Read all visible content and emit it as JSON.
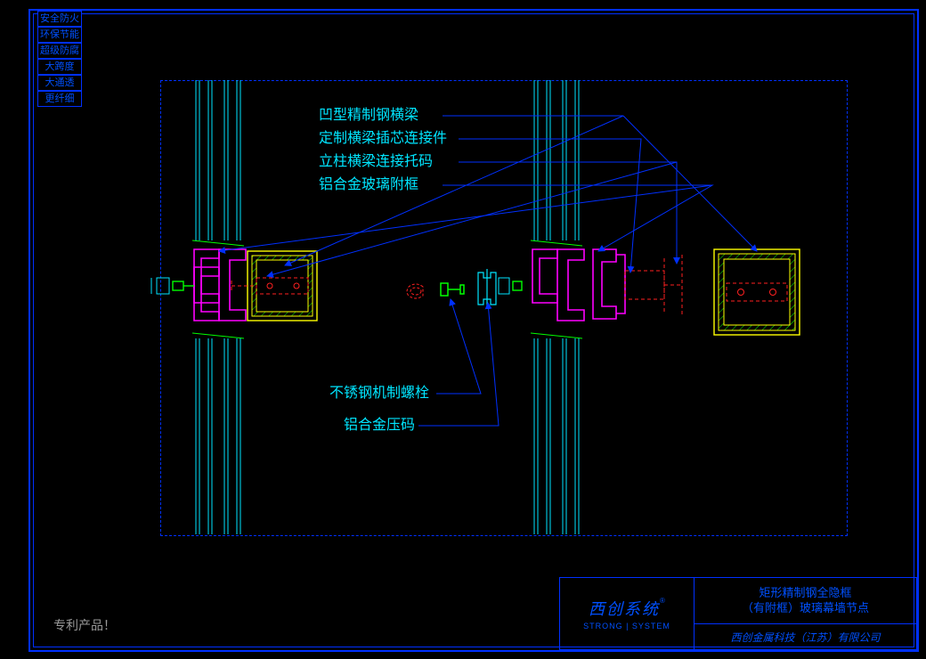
{
  "sidebar": {
    "tags": [
      "安全防火",
      "环保节能",
      "超级防腐",
      "大跨度",
      "大通透",
      "更纤细"
    ]
  },
  "labels": {
    "top1": "凹型精制钢横梁",
    "top2": "定制横梁插芯连接件",
    "top3": "立柱横梁连接托码",
    "top4": "铝合金玻璃附框",
    "bot1": "不锈钢机制螺栓",
    "bot2": "铝合金压码"
  },
  "patent": "专利产品！",
  "titleblock": {
    "brand": "西创系统",
    "reg": "®",
    "eng": "STRONG | SYSTEM",
    "title_l1": "矩形精制钢全隐框",
    "title_l2": "（有附框）玻璃幕墙节点",
    "company": "西创金属科技（江苏）有限公司"
  },
  "colors": {
    "frame": "#0030ff",
    "cyan": "#00e5ff",
    "magenta": "#ff00ff",
    "green": "#00ff00",
    "yellow": "#ffff00",
    "red": "#ff2020"
  }
}
